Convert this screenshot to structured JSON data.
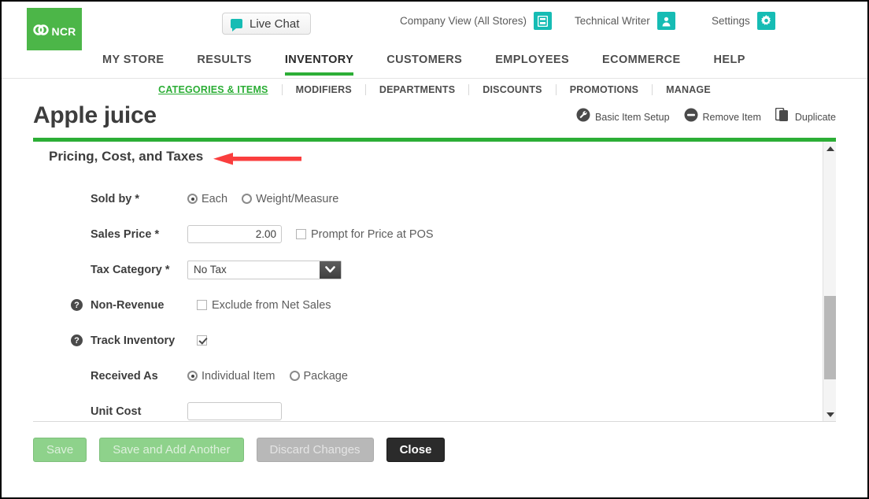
{
  "brand": {
    "logo_text": "NCR",
    "logo_color": "#4CB648",
    "accent_green": "#2CAE36",
    "accent_teal": "#16BCB4"
  },
  "topbar": {
    "live_chat": "Live Chat",
    "company_view": "Company View (All Stores)",
    "user_name": "Technical Writer",
    "settings": "Settings"
  },
  "mainnav": [
    {
      "label": "MY STORE",
      "active": false
    },
    {
      "label": "RESULTS",
      "active": false
    },
    {
      "label": "INVENTORY",
      "active": true
    },
    {
      "label": "CUSTOMERS",
      "active": false
    },
    {
      "label": "EMPLOYEES",
      "active": false
    },
    {
      "label": "ECOMMERCE",
      "active": false
    },
    {
      "label": "HELP",
      "active": false
    }
  ],
  "subnav": [
    {
      "label": "CATEGORIES & ITEMS",
      "active": true
    },
    {
      "label": "MODIFIERS",
      "active": false
    },
    {
      "label": "DEPARTMENTS",
      "active": false
    },
    {
      "label": "DISCOUNTS",
      "active": false
    },
    {
      "label": "PROMOTIONS",
      "active": false
    },
    {
      "label": "MANAGE",
      "active": false
    }
  ],
  "page": {
    "title": "Apple juice",
    "actions": [
      {
        "label": "Basic Item Setup",
        "icon": "wrench-icon"
      },
      {
        "label": "Remove Item",
        "icon": "minus-circle-icon"
      },
      {
        "label": "Duplicate",
        "icon": "duplicate-icon"
      }
    ]
  },
  "section": {
    "title": "Pricing, Cost, and Taxes",
    "annotation": "red-arrow-pointing-left"
  },
  "form": {
    "sold_by": {
      "label": "Sold by",
      "required": "*",
      "options": [
        {
          "label": "Each",
          "selected": true
        },
        {
          "label": "Weight/Measure",
          "selected": false
        }
      ]
    },
    "sales_price": {
      "label": "Sales Price",
      "required": "*",
      "value": "2.00",
      "prompt_label": "Prompt for Price at POS",
      "prompt_checked": false
    },
    "tax_category": {
      "label": "Tax Category",
      "required": "*",
      "value": "No Tax"
    },
    "non_revenue": {
      "label": "Non-Revenue",
      "help": "?",
      "checkbox_label": "Exclude from Net Sales",
      "checked": false
    },
    "track_inventory": {
      "label": "Track Inventory",
      "help": "?",
      "checked": true
    },
    "received_as": {
      "label": "Received As",
      "options": [
        {
          "label": "Individual Item",
          "selected": true
        },
        {
          "label": "Package",
          "selected": false
        }
      ]
    },
    "unit_cost": {
      "label": "Unit Cost",
      "value": ""
    }
  },
  "footer": {
    "save": "Save",
    "save_add_another": "Save and Add Another",
    "discard": "Discard Changes",
    "close": "Close"
  }
}
